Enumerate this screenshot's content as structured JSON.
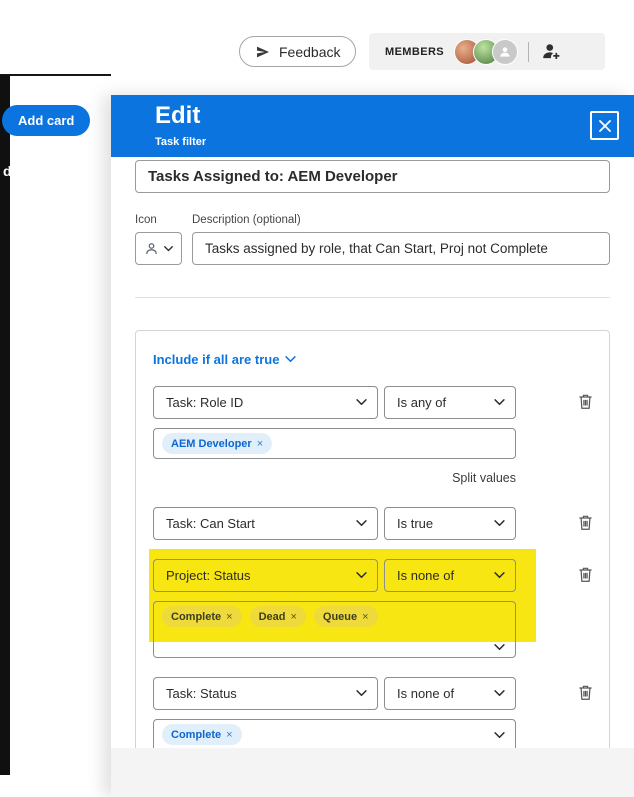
{
  "glyphs": {
    "chip_close": "×"
  },
  "topbar": {
    "feedback_label": "Feedback",
    "members_label": "MEMBERS"
  },
  "board": {
    "add_card_label": "Add card",
    "column_text_fragment": "d"
  },
  "panel": {
    "title": "Edit",
    "subtitle": "Task filter",
    "name_value": "Tasks Assigned to: AEM Developer",
    "icon_label": "Icon",
    "description_label": "Description (optional)",
    "description_value": "Tasks assigned by role, that Can Start, Proj not Complete"
  },
  "filter": {
    "include_label": "Include if all are true",
    "split_values_label": "Split values",
    "rows": [
      {
        "field": "Task: Role ID",
        "operator": "Is any of",
        "chips": [
          "AEM Developer"
        ],
        "highlighted": false
      },
      {
        "field": "Task: Can Start",
        "operator": "Is true",
        "chips": [],
        "highlighted": false
      },
      {
        "field": "Project: Status",
        "operator": "Is none of",
        "chips": [
          "Complete",
          "Dead",
          "Queue"
        ],
        "highlighted": true
      },
      {
        "field": "Task: Status",
        "operator": "Is none of",
        "chips": [
          "Complete"
        ],
        "highlighted": false
      }
    ]
  },
  "colors": {
    "accent": "#0b74de",
    "highlight": "#f7e611",
    "chip_bg": "#e1effb",
    "chip_text": "#0d66d0"
  }
}
